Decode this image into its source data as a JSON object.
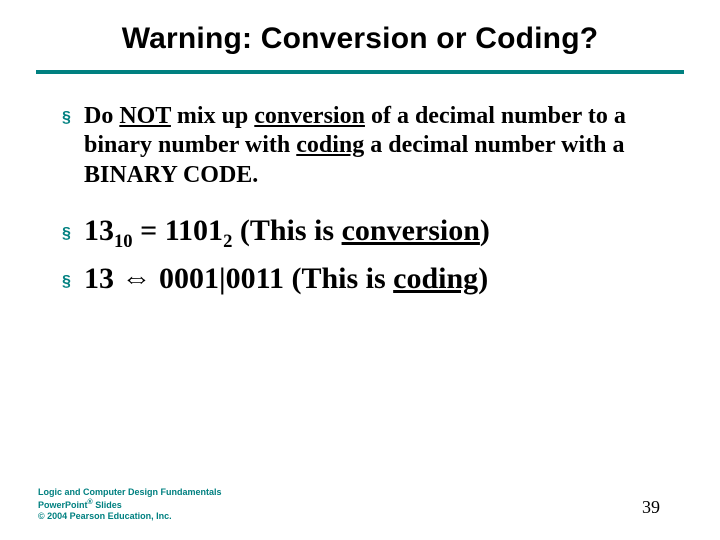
{
  "title": "Warning: Conversion or Coding?",
  "bullets": {
    "b1": {
      "pre": "Do ",
      "not": "NOT",
      "mid1": " mix up ",
      "conv": "conversion",
      "mid2": " of a decimal number to a binary number with ",
      "cod": "coding",
      "post": " a decimal number with a BINARY CODE."
    },
    "b2": {
      "n": "13",
      "sub1": "10",
      "eq": " = ",
      "bin": "1101",
      "sub2": "2",
      "open": " (This is ",
      "word": "conversion",
      "close": ")"
    },
    "b3": {
      "n": "13  ",
      "arrow": "⇔",
      "bits": " 0001|0011 (This is ",
      "word": "coding",
      "close": ")"
    }
  },
  "footer": {
    "l1a": "Logic and Computer Design Fundamentals",
    "l2a": "PowerPoint",
    "l2b": " Slides",
    "l3": "© 2004 Pearson Education, Inc."
  },
  "page": "39"
}
